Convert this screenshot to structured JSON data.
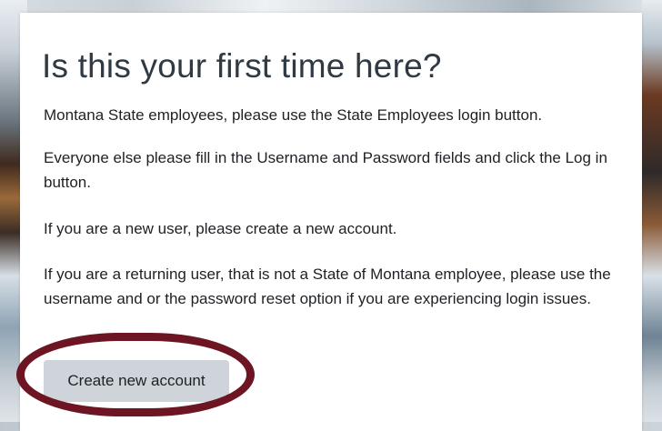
{
  "dialog": {
    "title": "Is this your first time here?",
    "paragraphs": [
      "Montana State employees, please use the State Employees login button.",
      "Everyone else please fill in the Username and Password fields and click the Log in button.",
      "If you are a new user, please create a new account.",
      "If you are a returning user, that is not a State of Montana employee, please use the username and or the password reset option if you are experiencing login issues."
    ],
    "create_button_label": "Create new account"
  },
  "colors": {
    "highlight_ring": "#6e1523",
    "button_bg": "#ced4da",
    "title_text": "#2f3a44"
  }
}
